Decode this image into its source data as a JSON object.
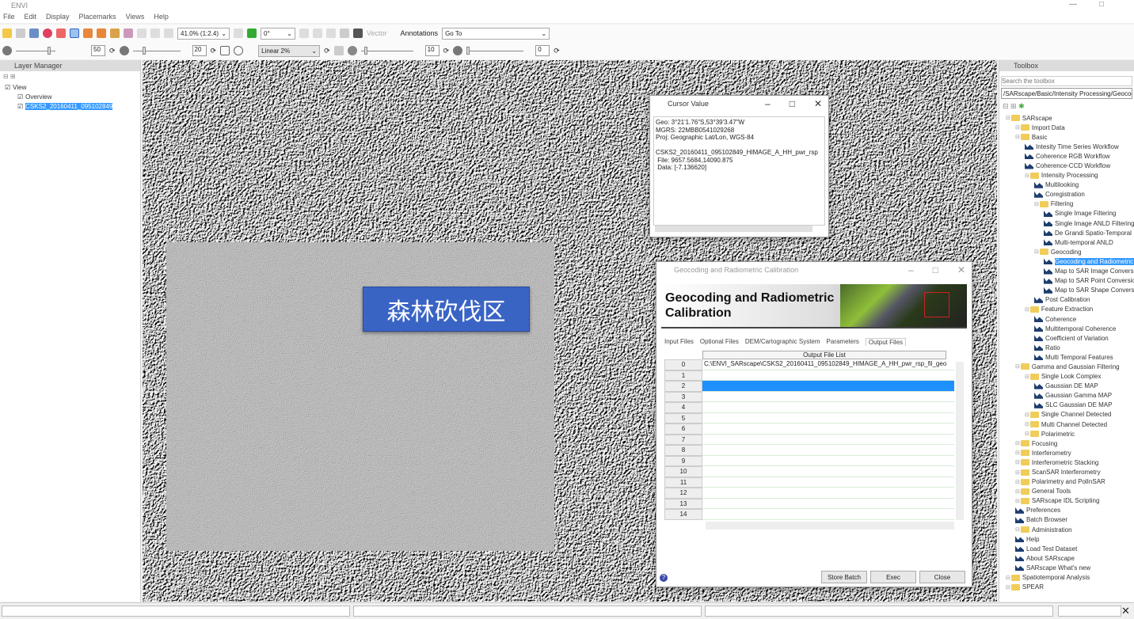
{
  "app": {
    "title": "ENVI"
  },
  "menu": [
    "File",
    "Edit",
    "Display",
    "Placemarks",
    "Views",
    "Help"
  ],
  "toolbar": {
    "zoom": "41.0% (1:2.4)",
    "rotation": "0°",
    "vector": "Vector",
    "annotations": "Annotations",
    "goto": "Go To",
    "brightness": "50",
    "contrast": "20",
    "stretch": "Linear 2%",
    "sharpen": "10",
    "transparency": "0"
  },
  "layer_manager": {
    "title": "Layer Manager",
    "items": [
      {
        "label": "View"
      },
      {
        "label": "Overview"
      },
      {
        "label": "CSKS2_20160411_095102849",
        "selected": true
      }
    ]
  },
  "overlay_label": "森林砍伐区",
  "cursor_value": {
    "title": "Cursor Value",
    "lines": [
      "Geo: 3°21'1.76\"S,53°39'3.47\"W",
      "MGRS: 22MBB0541029268",
      "Proj: Geographic Lat/Lon, WGS-84",
      "",
      "CSKS2_20160411_095102849_HIMAGE_A_HH_pwr_rsp",
      " File: 9657.5684,14090.875",
      " Data: [-7.136620]"
    ]
  },
  "dialog": {
    "title": "Geocoding and Radiometric Calibration",
    "banner": [
      "Geocoding and Radiometric",
      "Calibration"
    ],
    "tabs": [
      "Input Files",
      "Optional Files",
      "DEM/Cartographic System",
      "Parameters",
      "Output Files"
    ],
    "active_tab": "Output Files",
    "column": "Output File List",
    "rows": [
      "C:\\ENVI_SARscape\\CSKS2_20160411_095102849_HIMAGE_A_HH_pwr_rsp_fil_geo",
      "",
      "",
      "",
      "",
      "",
      "",
      "",
      "",
      "",
      "",
      "",
      "",
      "",
      ""
    ],
    "selected_row": 2,
    "buttons": {
      "store_batch": "Store Batch",
      "exec": "Exec",
      "close": "Close"
    },
    "help_icon": "?"
  },
  "toolbox": {
    "title": "Toolbox",
    "search_placeholder": "Search the toolbox",
    "path": "/SARscape/Basic/Intensity Processing/Geocoding",
    "tree": [
      {
        "label": "SARscape",
        "type": "folder",
        "level": 0
      },
      {
        "label": "Import Data",
        "type": "folder",
        "level": 1
      },
      {
        "label": "Basic",
        "type": "folder",
        "level": 1
      },
      {
        "label": "Intesity Time Series Workflow",
        "type": "tool",
        "level": 2
      },
      {
        "label": "Coherence RGB Workflow",
        "type": "tool",
        "level": 2
      },
      {
        "label": "Coherence-CCD Workflow",
        "type": "tool",
        "level": 2
      },
      {
        "label": "Intensity Processing",
        "type": "folder",
        "level": 2
      },
      {
        "label": "Multilooking",
        "type": "tool",
        "level": 3
      },
      {
        "label": "Coregistration",
        "type": "tool",
        "level": 3
      },
      {
        "label": "Filtering",
        "type": "folder",
        "level": 3
      },
      {
        "label": "Single Image Filtering",
        "type": "tool",
        "level": 4
      },
      {
        "label": "Single Image ANLD Filtering",
        "type": "tool",
        "level": 4
      },
      {
        "label": "De Grandi Spatio-Temporal",
        "type": "tool",
        "level": 4
      },
      {
        "label": "Multi-temporal ANLD",
        "type": "tool",
        "level": 4
      },
      {
        "label": "Geocoding",
        "type": "folder",
        "level": 3
      },
      {
        "label": "Geocoding and Radiometric Calibration",
        "type": "tool",
        "level": 4,
        "selected": true
      },
      {
        "label": "Map to SAR Image Conversion",
        "type": "tool",
        "level": 4
      },
      {
        "label": "Map to SAR Point Conversion",
        "type": "tool",
        "level": 4
      },
      {
        "label": "Map to SAR Shape Conversion",
        "type": "tool",
        "level": 4
      },
      {
        "label": "Post Calibration",
        "type": "tool",
        "level": 3
      },
      {
        "label": "Feature Extraction",
        "type": "folder",
        "level": 2
      },
      {
        "label": "Coherence",
        "type": "tool",
        "level": 3
      },
      {
        "label": "Multitemporal Coherence",
        "type": "tool",
        "level": 3
      },
      {
        "label": "Coefficient of Variation",
        "type": "tool",
        "level": 3
      },
      {
        "label": "Ratio",
        "type": "tool",
        "level": 3
      },
      {
        "label": "Multi Temporal Features",
        "type": "tool",
        "level": 3
      },
      {
        "label": "Gamma and Gaussian Filtering",
        "type": "folder",
        "level": 1
      },
      {
        "label": "Single Look Complex",
        "type": "folder",
        "level": 2
      },
      {
        "label": "Gaussian DE MAP",
        "type": "tool",
        "level": 3
      },
      {
        "label": "Gaussian Gamma MAP",
        "type": "tool",
        "level": 3
      },
      {
        "label": "SLC Gaussian DE MAP",
        "type": "tool",
        "level": 3
      },
      {
        "label": "Single Channel Detected",
        "type": "folder",
        "level": 2
      },
      {
        "label": "Multi Channel Detected",
        "type": "folder",
        "level": 2
      },
      {
        "label": "Polarimetric",
        "type": "folder",
        "level": 2
      },
      {
        "label": "Focusing",
        "type": "folder",
        "level": 1
      },
      {
        "label": "Interferometry",
        "type": "folder",
        "level": 1
      },
      {
        "label": "Interferometric Stacking",
        "type": "folder",
        "level": 1
      },
      {
        "label": "ScanSAR Interferometry",
        "type": "folder",
        "level": 1
      },
      {
        "label": "Polarimetry and PolInSAR",
        "type": "folder",
        "level": 1
      },
      {
        "label": "General Tools",
        "type": "folder",
        "level": 1
      },
      {
        "label": "SARscape IDL Scripting",
        "type": "folder",
        "level": 1
      },
      {
        "label": "Preferences",
        "type": "tool",
        "level": 1
      },
      {
        "label": "Batch Browser",
        "type": "tool",
        "level": 1
      },
      {
        "label": "Administration",
        "type": "folder",
        "level": 1
      },
      {
        "label": "Help",
        "type": "tool",
        "level": 1
      },
      {
        "label": "Load Test Dataset",
        "type": "tool",
        "level": 1
      },
      {
        "label": "About SARscape",
        "type": "tool",
        "level": 1
      },
      {
        "label": "SARscape What's new",
        "type": "tool",
        "level": 1
      },
      {
        "label": "Spatiotemporal Analysis",
        "type": "folder",
        "level": 0
      },
      {
        "label": "SPEAR",
        "type": "folder",
        "level": 0
      }
    ]
  }
}
